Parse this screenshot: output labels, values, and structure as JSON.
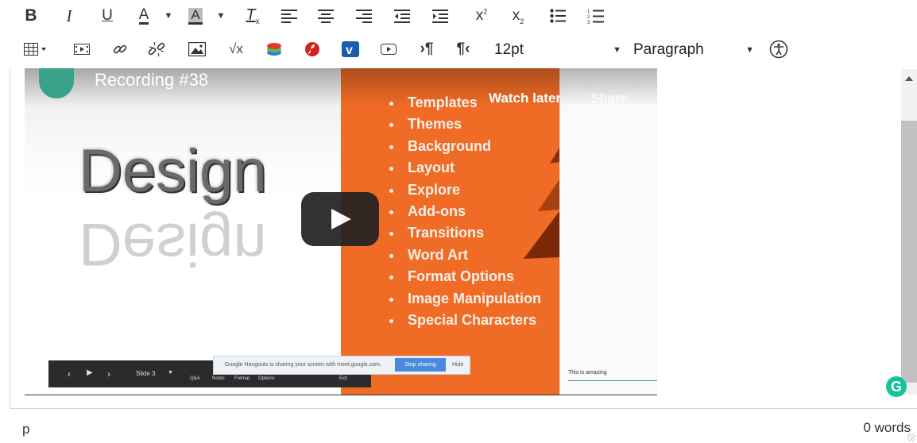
{
  "toolbar": {
    "font_size": "12pt",
    "block_format": "Paragraph",
    "superscript_glyph": "x",
    "subscript_glyph": "x"
  },
  "video": {
    "title": "Recording #38",
    "watch_later": "Watch later",
    "share": "Share",
    "slide_heading": "Design",
    "slide_items": [
      "Templates",
      "Themes",
      "Background",
      "Layout",
      "Explore",
      "Add-ons",
      "Transitions",
      "Word Art",
      "Format Options",
      "Image Manipulation",
      "Special Characters"
    ],
    "slide_indicator": "Slide 3",
    "controls": [
      "Q&A",
      "Notes",
      "Format",
      "Options",
      "Exit"
    ],
    "sharing_notice": "Google Hangouts is sharing your screen with meet.google.com.",
    "stop_sharing": "Stop sharing",
    "hide": "Hide",
    "comment": "This is amazing"
  },
  "status": {
    "path": "p",
    "word_count": "0 words"
  },
  "colors": {
    "slide_orange": "#ef6b26",
    "grammarly_green": "#15c39a"
  }
}
